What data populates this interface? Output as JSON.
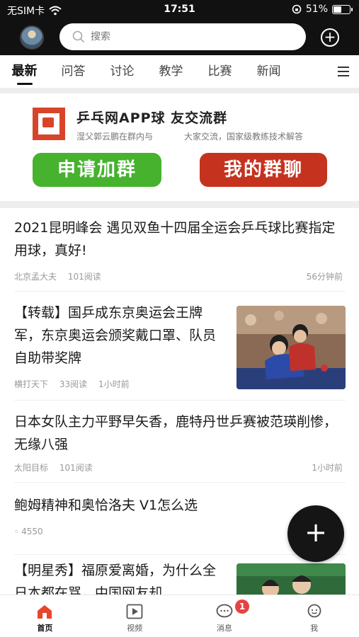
{
  "status_bar": {
    "carrier": "无SIM卡",
    "time": "17:51",
    "battery": "51%",
    "battery_level": 0.51
  },
  "header": {
    "search_placeholder": "搜索",
    "add_icon": "plus-circle-icon"
  },
  "tabs": [
    {
      "label": "最新",
      "active": true
    },
    {
      "label": "问答"
    },
    {
      "label": "讨论"
    },
    {
      "label": "教学"
    },
    {
      "label": "比赛"
    },
    {
      "label": "新闻"
    }
  ],
  "banner": {
    "title": "乒乓网APP球  友交流群",
    "subtitle_left": "湿父郭云鹏在群内与",
    "subtitle_right": "大家交流，国家级教练技术解答",
    "button_join": "申请加群",
    "button_my": "我的群聊",
    "colors": {
      "join": "#46b22e",
      "my": "#c5331f",
      "logo": "#d8442a"
    }
  },
  "articles": [
    {
      "title": "2021昆明峰会  遇见双鱼十四届全运会乒乓球比赛指定用球，真好!",
      "author": "北京孟大夫",
      "reads": "101阅读",
      "time": "56分钟前"
    },
    {
      "title": "【转载】国乒成东京奥运会王牌军，东京奥运会颁奖戴口罩、队员自助带奖牌",
      "author": "横打天下",
      "reads": "33阅读",
      "time": "1小时前"
    },
    {
      "title": "日本女队主力平野早矢香，鹿特丹世乒赛被范瑛削惨，无缘八强",
      "author": "太阳目标",
      "reads": "101阅读",
      "time": "1小时前"
    },
    {
      "title": "鲍姆精神和奥恰洛夫 V1怎么选",
      "reads": "4550"
    },
    {
      "title": "【明星秀】福原爱离婚，为什么全日本都在骂，中国网友却"
    }
  ],
  "bottom_nav": [
    {
      "label": "首页",
      "icon": "home-icon",
      "active": true
    },
    {
      "label": "视频",
      "icon": "video-icon"
    },
    {
      "label": "消息",
      "icon": "message-icon",
      "badge": "1"
    },
    {
      "label": "我",
      "icon": "profile-icon"
    }
  ]
}
